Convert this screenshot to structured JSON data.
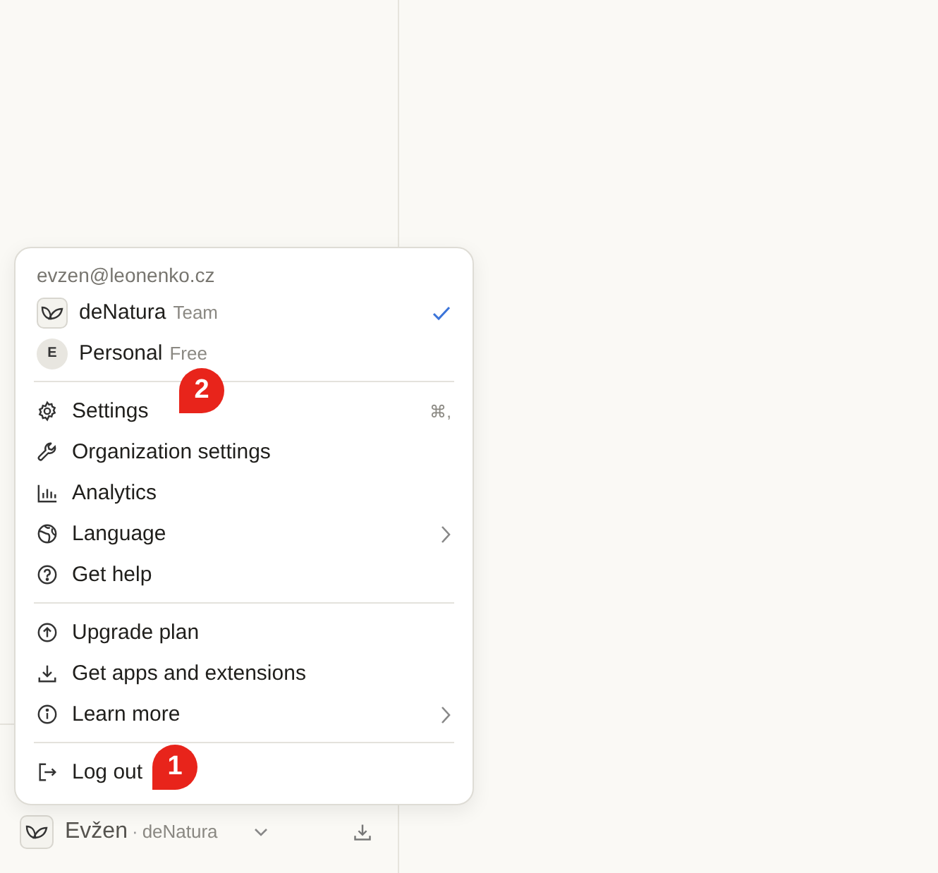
{
  "account": {
    "email": "evzen@leonenko.cz",
    "workspaces": [
      {
        "name": "deNatura",
        "plan": "Team",
        "kind": "logo",
        "selected": true
      },
      {
        "name": "Personal",
        "plan": "Free",
        "kind": "letter",
        "initial": "E",
        "selected": false
      }
    ]
  },
  "menu": {
    "sections": [
      [
        {
          "label": "Settings",
          "shortcut": "⌘,",
          "submenu": false
        },
        {
          "label": "Organization settings",
          "submenu": false
        },
        {
          "label": "Analytics",
          "submenu": false
        },
        {
          "label": "Language",
          "submenu": true
        },
        {
          "label": "Get help",
          "submenu": false
        }
      ],
      [
        {
          "label": "Upgrade plan",
          "submenu": false
        },
        {
          "label": "Get apps and extensions",
          "submenu": false
        },
        {
          "label": "Learn more",
          "submenu": true
        }
      ],
      [
        {
          "label": "Log out",
          "submenu": false
        }
      ]
    ]
  },
  "footer": {
    "user": "Evžen",
    "separator": "·",
    "workspace": "deNatura"
  },
  "callouts": [
    {
      "number": "1"
    },
    {
      "number": "2"
    }
  ]
}
